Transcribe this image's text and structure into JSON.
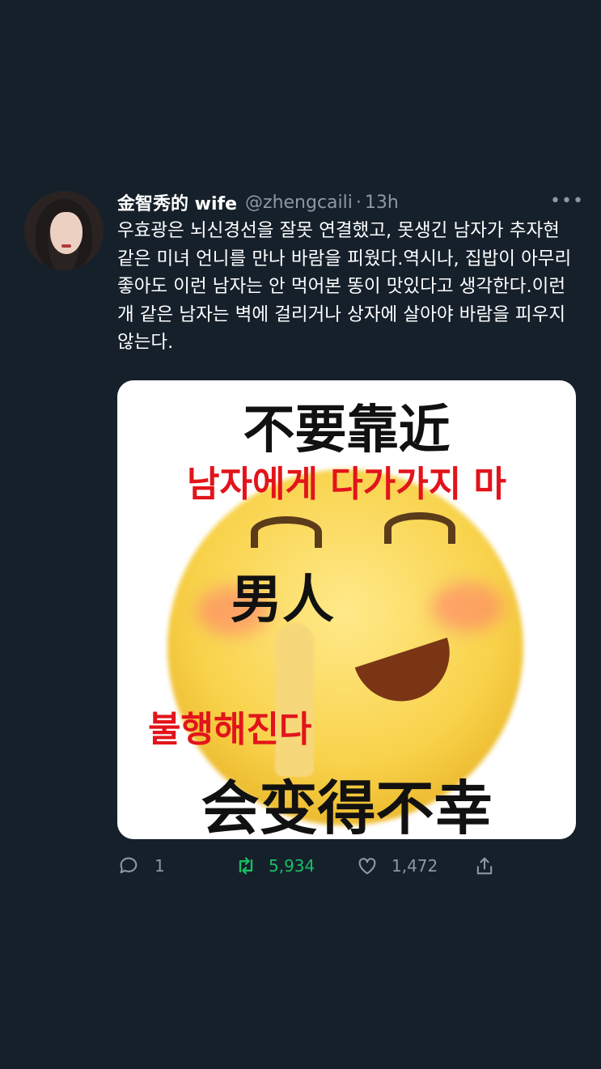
{
  "tweet": {
    "display_name": "金智秀的 wife",
    "handle": "@zhengcaili",
    "separator": "·",
    "time": "13h",
    "more": "•••",
    "text": "우효광은 뇌신경선을 잘못 연결했고, 못생긴 남자가 추자현 같은 미녀 언니를 만나 바람을 피웠다.역시나, 집밥이 아무리 좋아도 이런 남자는 안 먹어본 똥이 맛있다고 생각한다.이런 개 같은 남자는 벽에 걸리거나 상자에 살아야 바람을 피우지 않는다."
  },
  "media": {
    "caption_zh_top": "不要靠近",
    "caption_ko_top": "남자에게 다가가지 마",
    "caption_zh_mid": "男人",
    "caption_ko_bottom": "불행해진다",
    "caption_zh_bottom": "会变得不幸"
  },
  "actions": {
    "replies": "1",
    "retweets": "5,934",
    "likes": "1,472",
    "icons": [
      "reply-icon",
      "retweet-icon",
      "like-icon",
      "share-icon"
    ],
    "retweet_color": "#17bf63"
  }
}
